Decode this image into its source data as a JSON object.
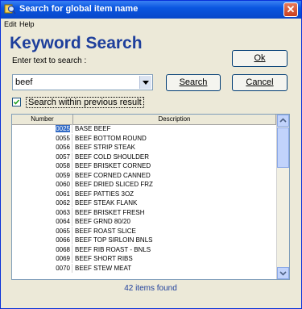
{
  "window": {
    "title": "Search for global item name"
  },
  "menu": [
    {
      "label": "Edit"
    },
    {
      "label": "Help"
    }
  ],
  "header": {
    "heading": "Keyword Search",
    "prompt": "Enter text to search :"
  },
  "search": {
    "value": "beef"
  },
  "buttons": {
    "ok": "Ok",
    "search": "Search",
    "cancel": "Cancel"
  },
  "options": {
    "within_previous": {
      "label": "Search within previous result",
      "checked": true
    }
  },
  "grid": {
    "columns": [
      "Number",
      "Description"
    ],
    "rows": [
      {
        "number": "0025",
        "description": "BASE BEEF",
        "selected": true
      },
      {
        "number": "0055",
        "description": "BEEF BOTTOM ROUND"
      },
      {
        "number": "0056",
        "description": "BEEF STRIP STEAK"
      },
      {
        "number": "0057",
        "description": "BEEF COLD SHOULDER"
      },
      {
        "number": "0058",
        "description": "BEEF BRISKET CORNED"
      },
      {
        "number": "0059",
        "description": "BEEF CORNED CANNED"
      },
      {
        "number": "0060",
        "description": "BEEF DRIED SLICED FRZ"
      },
      {
        "number": "0061",
        "description": "BEEF PATTIES 3OZ"
      },
      {
        "number": "0062",
        "description": "BEEF STEAK FLANK"
      },
      {
        "number": "0063",
        "description": "BEEF BRISKET FRESH"
      },
      {
        "number": "0064",
        "description": "BEEF GRND 80/20"
      },
      {
        "number": "0065",
        "description": "BEEF ROAST SLICE"
      },
      {
        "number": "0066",
        "description": "BEEF TOP SIRLOIN BNLS"
      },
      {
        "number": "0068",
        "description": "BEEF RIB ROAST - BNLS"
      },
      {
        "number": "0069",
        "description": "BEEF SHORT RIBS"
      },
      {
        "number": "0070",
        "description": "BEEF STEW MEAT"
      }
    ]
  },
  "status": {
    "text": "42 items found"
  },
  "colors": {
    "title_bar": "#0a56e0",
    "heading": "#1e3f9c",
    "selection": "#316ac5"
  }
}
